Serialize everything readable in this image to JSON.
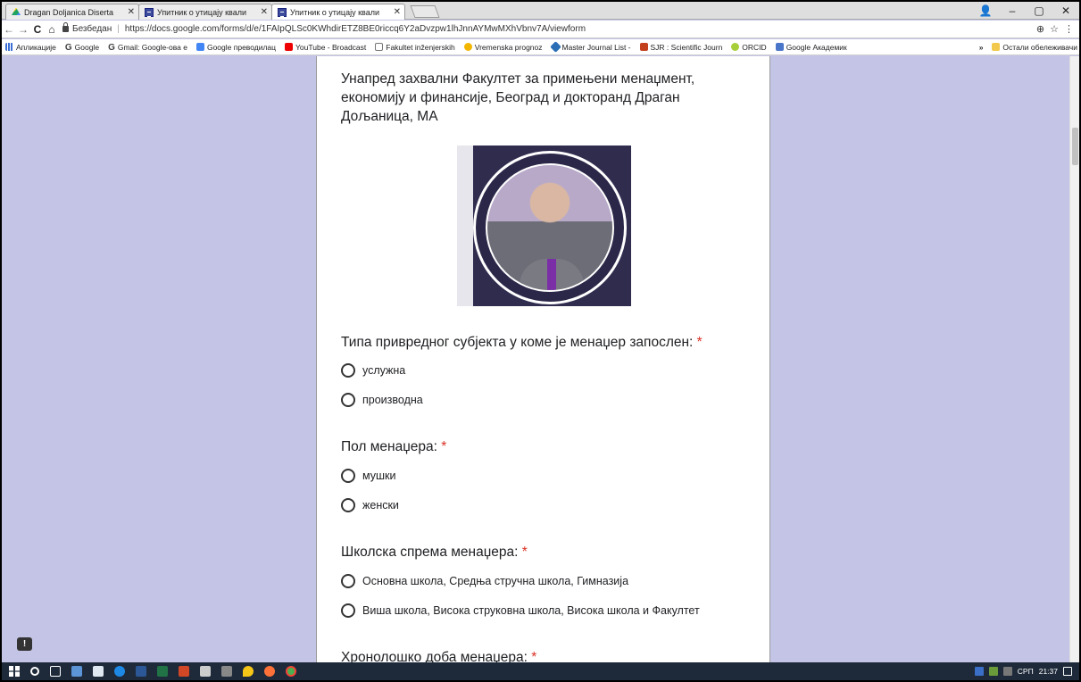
{
  "tabs": [
    {
      "title": "Dragan Doljanica Diserta",
      "icon": "drive-icon"
    },
    {
      "title": "Упитник о утицају квали",
      "icon": "forms-icon"
    },
    {
      "title": "Упитник о утицају квали",
      "icon": "forms-icon"
    }
  ],
  "window": {
    "profile": "👤",
    "minimize": "–",
    "restore": "▢",
    "close": "✕"
  },
  "address": {
    "secure_label": "Безбедан",
    "separator": "|",
    "url": "https://docs.google.com/forms/d/e/1FAIpQLSc0KWhdirETZ8BE0riccq6Y2aDvzpw1lhJnnAYMwMXhVbnv7A/viewform",
    "zoom_icon": "⊕",
    "star_icon": "☆",
    "menu_icon": "⋮",
    "back": "←",
    "forward": "→",
    "reload": "C",
    "home": "⌂"
  },
  "bookmarks": [
    {
      "label": "Апликације",
      "icon": "apps"
    },
    {
      "label": "Google",
      "icon": "g"
    },
    {
      "label": "Gmail: Google-ова е",
      "icon": "g"
    },
    {
      "label": "Google преводилац",
      "icon": "gt"
    },
    {
      "label": "YouTube - Broadcast",
      "icon": "yt"
    },
    {
      "label": "Fakultet inženjerskih",
      "icon": "doc"
    },
    {
      "label": "Vremenska prognoz",
      "icon": "weather"
    },
    {
      "label": "Master Journal List -",
      "icon": "mj"
    },
    {
      "label": "SJR : Scientific Journ",
      "icon": "sjr"
    },
    {
      "label": "ORCID",
      "icon": "orcid"
    },
    {
      "label": "Google Академик",
      "icon": "scholar"
    }
  ],
  "bookmarks_more": "»",
  "bookmarks_other": "Остали обележивачи",
  "form": {
    "intro": "Унапред захвални Факултет за примењени менаџмент, економију и финансије, Београд и докторанд Драган Дољаница, МА",
    "required_mark": "*",
    "questions": [
      {
        "title": "Типа привредног субјекта у коме је менаџер запослен:",
        "options": [
          "услужна",
          "производна"
        ]
      },
      {
        "title": "Пол менаџера:",
        "options": [
          "мушки",
          "женски"
        ]
      },
      {
        "title": "Школска спрема менаџера:",
        "options": [
          "Основна школа, Средња стручна школа, Гимназија",
          "Виша школа, Висока струковна школа, Висока школа и Факултет"
        ]
      },
      {
        "title": "Хронолошко доба менаџера:",
        "options": []
      }
    ]
  },
  "feedback_label": "!",
  "taskbar": {
    "lang": "СРП",
    "time": "21:37"
  }
}
